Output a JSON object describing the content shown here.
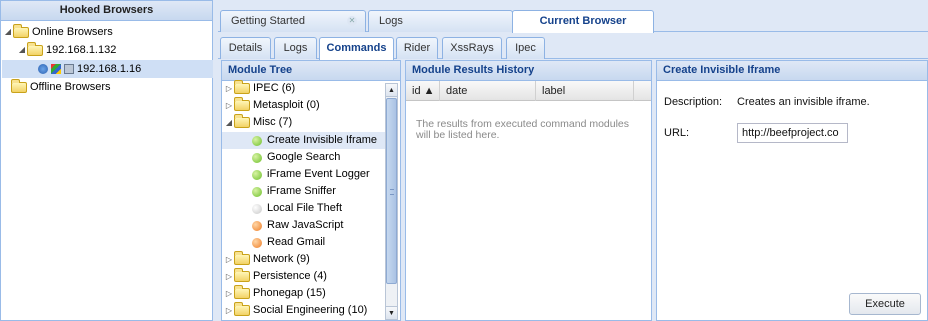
{
  "hooked": {
    "title": "Hooked Browsers",
    "online_label": "Online Browsers",
    "ip_group": "192.168.1.132",
    "browser_ip": "192.168.1.16",
    "offline_label": "Offline Browsers"
  },
  "tabs": [
    {
      "label": "Getting Started"
    },
    {
      "label": "Logs"
    },
    {
      "label": "Current Browser"
    }
  ],
  "subtabs": [
    {
      "label": "Details"
    },
    {
      "label": "Logs"
    },
    {
      "label": "Commands"
    },
    {
      "label": "Rider"
    },
    {
      "label": "XssRays"
    },
    {
      "label": "Ipec"
    }
  ],
  "module_tree": {
    "title": "Module Tree",
    "items": [
      {
        "label": "IPEC (6)"
      },
      {
        "label": "Metasploit (0)"
      },
      {
        "label": "Misc (7)"
      },
      {
        "label": "Create Invisible Iframe"
      },
      {
        "label": "Google Search"
      },
      {
        "label": "iFrame Event Logger"
      },
      {
        "label": "iFrame Sniffer"
      },
      {
        "label": "Local File Theft"
      },
      {
        "label": "Raw JavaScript"
      },
      {
        "label": "Read Gmail"
      },
      {
        "label": "Network (9)"
      },
      {
        "label": "Persistence (4)"
      },
      {
        "label": "Phonegap (15)"
      },
      {
        "label": "Social Engineering (10)"
      }
    ]
  },
  "results": {
    "title": "Module Results History",
    "col_id": "id ▲",
    "col_date": "date",
    "col_label": "label",
    "empty": "The results from executed command modules will be listed here."
  },
  "create": {
    "title": "Create Invisible Iframe",
    "desc_label": "Description:",
    "desc_value": "Creates an invisible iframe.",
    "url_label": "URL:",
    "url_value": "http://beefproject.co",
    "execute_label": "Execute"
  },
  "colors": {
    "accent": "#15428b",
    "panel_bg": "#dfe8f6",
    "border": "#99bbe8"
  }
}
